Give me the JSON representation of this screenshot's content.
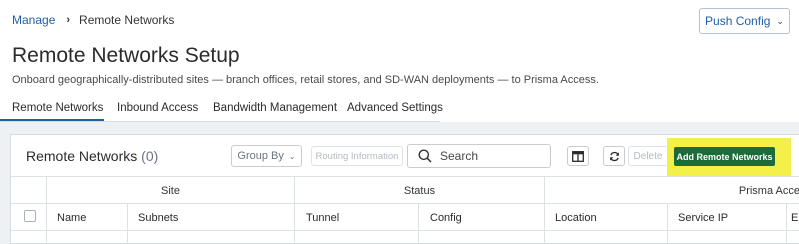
{
  "breadcrumb": {
    "parent": "Manage",
    "separator": "›",
    "current": "Remote Networks"
  },
  "header": {
    "push_config_label": "Push Config",
    "push_chevron": "⌄"
  },
  "page": {
    "title": "Remote Networks Setup",
    "subtitle": "Onboard geographically-distributed sites — branch offices, retail stores, and SD-WAN deployments — to Prisma Access."
  },
  "tabs": [
    {
      "label": "Remote Networks",
      "active": true
    },
    {
      "label": "Inbound Access",
      "active": false
    },
    {
      "label": "Bandwidth Management",
      "active": false
    },
    {
      "label": "Advanced Settings",
      "active": false
    }
  ],
  "panel": {
    "title": "Remote Networks",
    "count": "(0)",
    "group_by_label": "Group By",
    "group_by_chevron": "⌄",
    "routing_label": "Routing Information",
    "search_placeholder": "Search",
    "delete_label": "Delete",
    "add_label": "Add Remote Networks"
  },
  "table": {
    "groups": [
      "Site",
      "Status",
      "Prisma Acce"
    ],
    "columns": [
      "Name",
      "Subnets",
      "Tunnel",
      "Config",
      "Location",
      "Service IP",
      "E"
    ]
  },
  "colors": {
    "accent": "#1f5fa8",
    "add_button": "#1c6b3a",
    "highlight": "#f3f04a"
  }
}
